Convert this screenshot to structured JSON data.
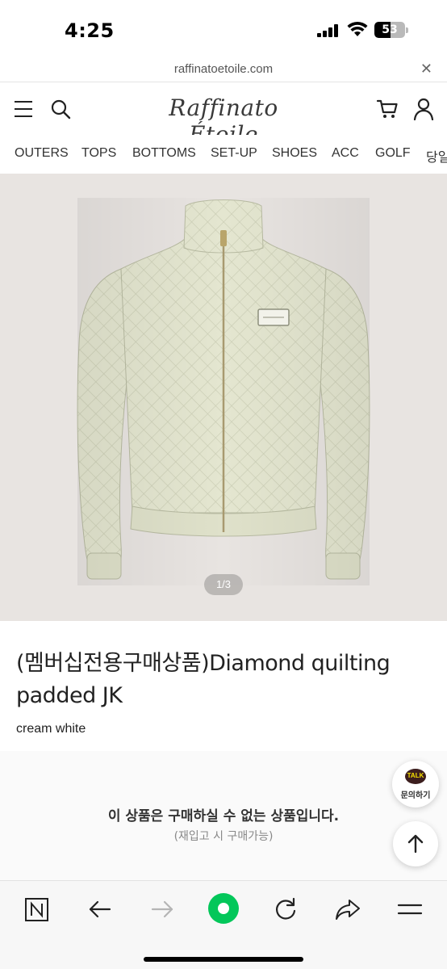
{
  "status_bar": {
    "time": "4:25",
    "battery_level": "53",
    "battery_fraction": 0.53
  },
  "browser": {
    "url": "raffinatoetoile.com",
    "close_icon": "close-icon"
  },
  "header": {
    "logo_text": "Raffinato Étoile",
    "menu_icon": "hamburger-menu-icon",
    "search_icon": "search-icon",
    "cart_icon": "cart-icon",
    "user_icon": "user-icon"
  },
  "categories": [
    "OUTERS",
    "TOPS",
    "BOTTOMS",
    "SET-UP",
    "SHOES",
    "ACC",
    "GOLF",
    "당일"
  ],
  "gallery": {
    "pager": "1/3",
    "background": "#e8e4e1",
    "product_color": "#e4e6d0"
  },
  "product": {
    "title": "(멤버십전용구매상품)Diamond quilting padded JK",
    "option": "cream white"
  },
  "purchase_notice": {
    "main": "이 상품은 구매하실 수 없는 상품입니다.",
    "sub": "(재입고 시 구매가능)"
  },
  "floating": {
    "talk_badge": "TALK",
    "talk_label": "문의하기",
    "top_icon": "arrow-up-icon"
  },
  "toolbar": {
    "icons": [
      "naver-icon",
      "back-arrow-icon",
      "forward-arrow-icon",
      "green-home-icon",
      "refresh-icon",
      "share-icon",
      "menu-icon"
    ],
    "accent": "#03c75a"
  }
}
